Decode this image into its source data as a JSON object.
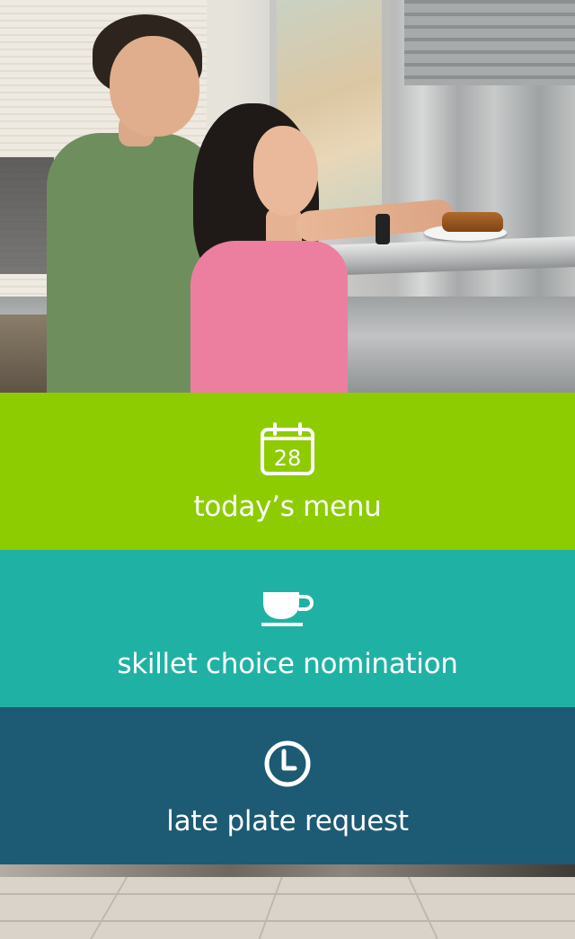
{
  "colors": {
    "menu_tile": "#8dcc00",
    "skillet_tile": "#1fb2a4",
    "late_plate_tile": "#1d5a73",
    "text": "#ffffff"
  },
  "hero": {
    "image": "students-at-dining-hall-serving-counter"
  },
  "tiles": [
    {
      "label": "today’s menu",
      "icon": "calendar-icon",
      "icon_text": "28"
    },
    {
      "label": "skillet choice nomination",
      "icon": "coffee-cup-icon"
    },
    {
      "label": "late plate request",
      "icon": "clock-icon"
    }
  ]
}
